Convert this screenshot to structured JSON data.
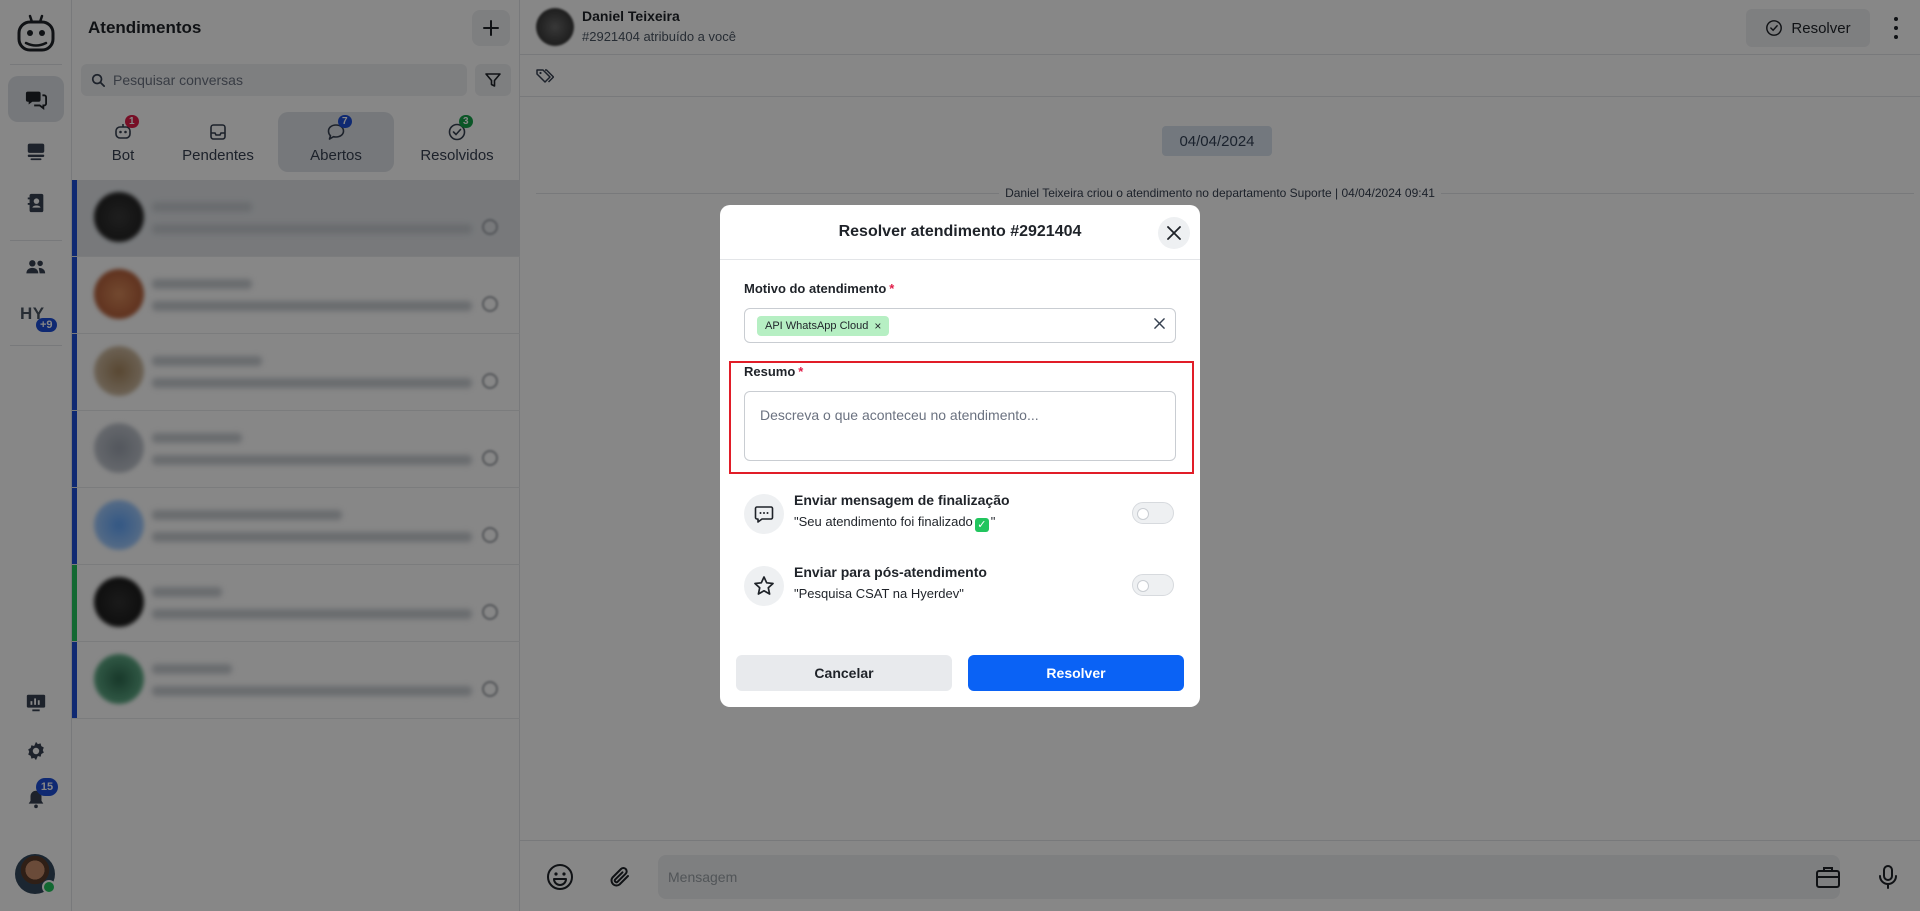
{
  "list": {
    "title": "Atendimentos",
    "search_placeholder": "Pesquisar conversas",
    "tabs": [
      {
        "label": "Bot",
        "count": "1",
        "count_color": "#e11d48"
      },
      {
        "label": "Pendentes",
        "count": "",
        "count_color": ""
      },
      {
        "label": "Abertos",
        "count": "7",
        "count_color": "#1d4fd8"
      },
      {
        "label": "Resolvidos",
        "count": "3",
        "count_color": "#16a34a"
      }
    ]
  },
  "rail": {
    "workspace_initials": "HY",
    "workspace_badge": "+9",
    "notifications_count": "15"
  },
  "chat": {
    "contact_name": "Daniel Teixeira",
    "assignment": "#2921404 atribuído a você",
    "resolve_label": "Resolver",
    "date_chip": "04/04/2024",
    "system_message": "Daniel Teixeira criou o atendimento no departamento Suporte | 04/04/2024 09:41",
    "message_placeholder": "Mensagem"
  },
  "modal": {
    "title": "Resolver atendimento #2921404",
    "reason_label": "Motivo do atendimento",
    "reason_tag": "API WhatsApp Cloud",
    "summary_label": "Resumo",
    "summary_placeholder": "Descreva o que aconteceu no atendimento...",
    "required_mark": "*",
    "option_finish_title": "Enviar mensagem de finalização",
    "option_finish_desc_pre": "\"Seu atendimento foi finalizado",
    "option_finish_desc_post": "\"",
    "option_post_title": "Enviar para pós-atendimento",
    "option_post_desc": "\"Pesquisa CSAT na Hyerdev\"",
    "cancel_label": "Cancelar",
    "resolve_label": "Resolver"
  },
  "colors": {
    "primary": "#0a62f5",
    "tag_bg": "#b6efc3",
    "highlight": "#e11d28"
  }
}
